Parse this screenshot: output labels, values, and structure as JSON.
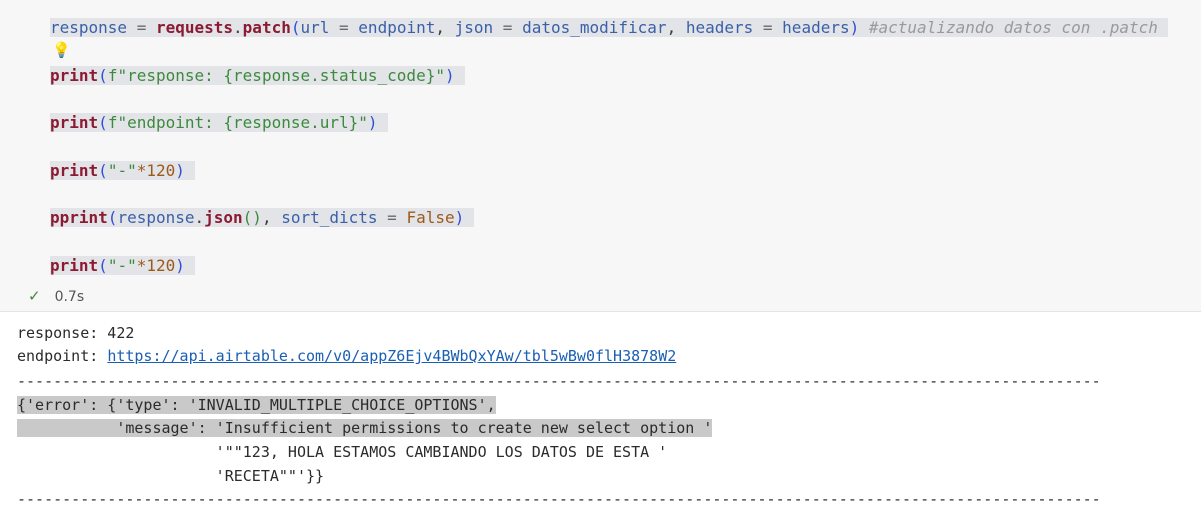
{
  "code": {
    "line1": {
      "var": "response",
      "eq": " = ",
      "obj": "requests",
      "dot": ".",
      "method": "patch",
      "open": "(",
      "arg1": "url",
      "eq1": " = ",
      "val1": "endpoint",
      "comma1": ", ",
      "arg2": "json",
      "eq2": " = ",
      "val2": "datos_modificar",
      "comma2": ", ",
      "arg3": "headers",
      "eq3": " = ",
      "val3": "headers",
      "close": ")",
      "comment": " #actualizando datos con .patch"
    },
    "line2": {
      "fn": "print",
      "open": "(",
      "str": "f\"response: {response.status_code}\"",
      "close": ")"
    },
    "line3": {
      "fn": "print",
      "open": "(",
      "str": "f\"endpoint: {response.url}\"",
      "close": ")"
    },
    "line4": {
      "fn": "print",
      "open": "(",
      "str": "\"-\"",
      "op": "*120",
      "close": ")"
    },
    "line5": {
      "fn": "pprint",
      "open": "(",
      "obj": "response",
      "dot": ".",
      "method": "json",
      "call": "()",
      "comma": ", ",
      "arg": "sort_dicts",
      "eq": " = ",
      "val": "False",
      "close": ")"
    },
    "line6": {
      "fn": "print",
      "open": "(",
      "str": "\"-\"",
      "op": "*120",
      "close": ")"
    }
  },
  "status": {
    "check": "✓",
    "time": "0.7s"
  },
  "output": {
    "response_line": "response: 422",
    "endpoint_label": "endpoint: ",
    "endpoint_url": "https://api.airtable.com/v0/appZ6Ejv4BWbQxYAw/tbl5wBw0flH3878W2",
    "separator": "------------------------------------------------------------------------------------------------------------------------",
    "err1": "{'error': {'type': 'INVALID_MULTIPLE_CHOICE_OPTIONS',",
    "err2": "           'message': 'Insufficient permissions to create new select option '",
    "err3": "                      '\"\"123, HOLA ESTAMOS CAMBIANDO LOS DATOS DE ESTA '",
    "err4": "                      'RECETA\"\"'}}",
    "separator2": "------------------------------------------------------------------------------------------------------------------------"
  }
}
